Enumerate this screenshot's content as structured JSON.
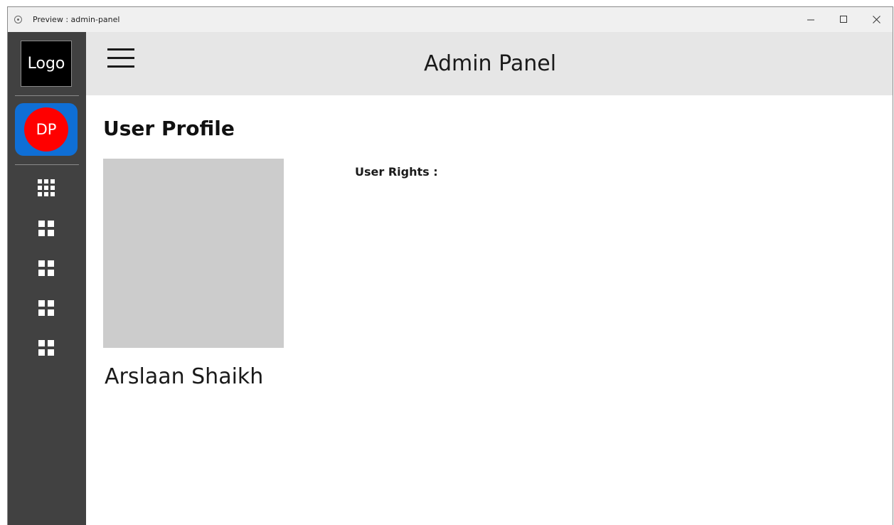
{
  "window": {
    "title": "Preview : admin-panel",
    "controls": [
      "minimize-icon",
      "maximize-icon",
      "close-icon"
    ]
  },
  "sidebar": {
    "logo_text": "Logo",
    "avatar_initials": "DP",
    "colors": {
      "background": "#414141",
      "profile_tile": "#0f6fd6",
      "avatar": "#ff0000"
    },
    "nav_icons": [
      "grid-3x3-icon",
      "grid-2x2-icon",
      "grid-2x2-icon",
      "grid-2x2-icon",
      "grid-2x2-icon"
    ]
  },
  "header": {
    "menu_icon": "hamburger-menu-icon",
    "title": "Admin Panel",
    "background": "#e6e6e6"
  },
  "main": {
    "page_title": "User Profile",
    "user_name": "Arslaan Shaikh",
    "user_rights_label": "User Rights :",
    "photo_placeholder_color": "#cccccc"
  }
}
